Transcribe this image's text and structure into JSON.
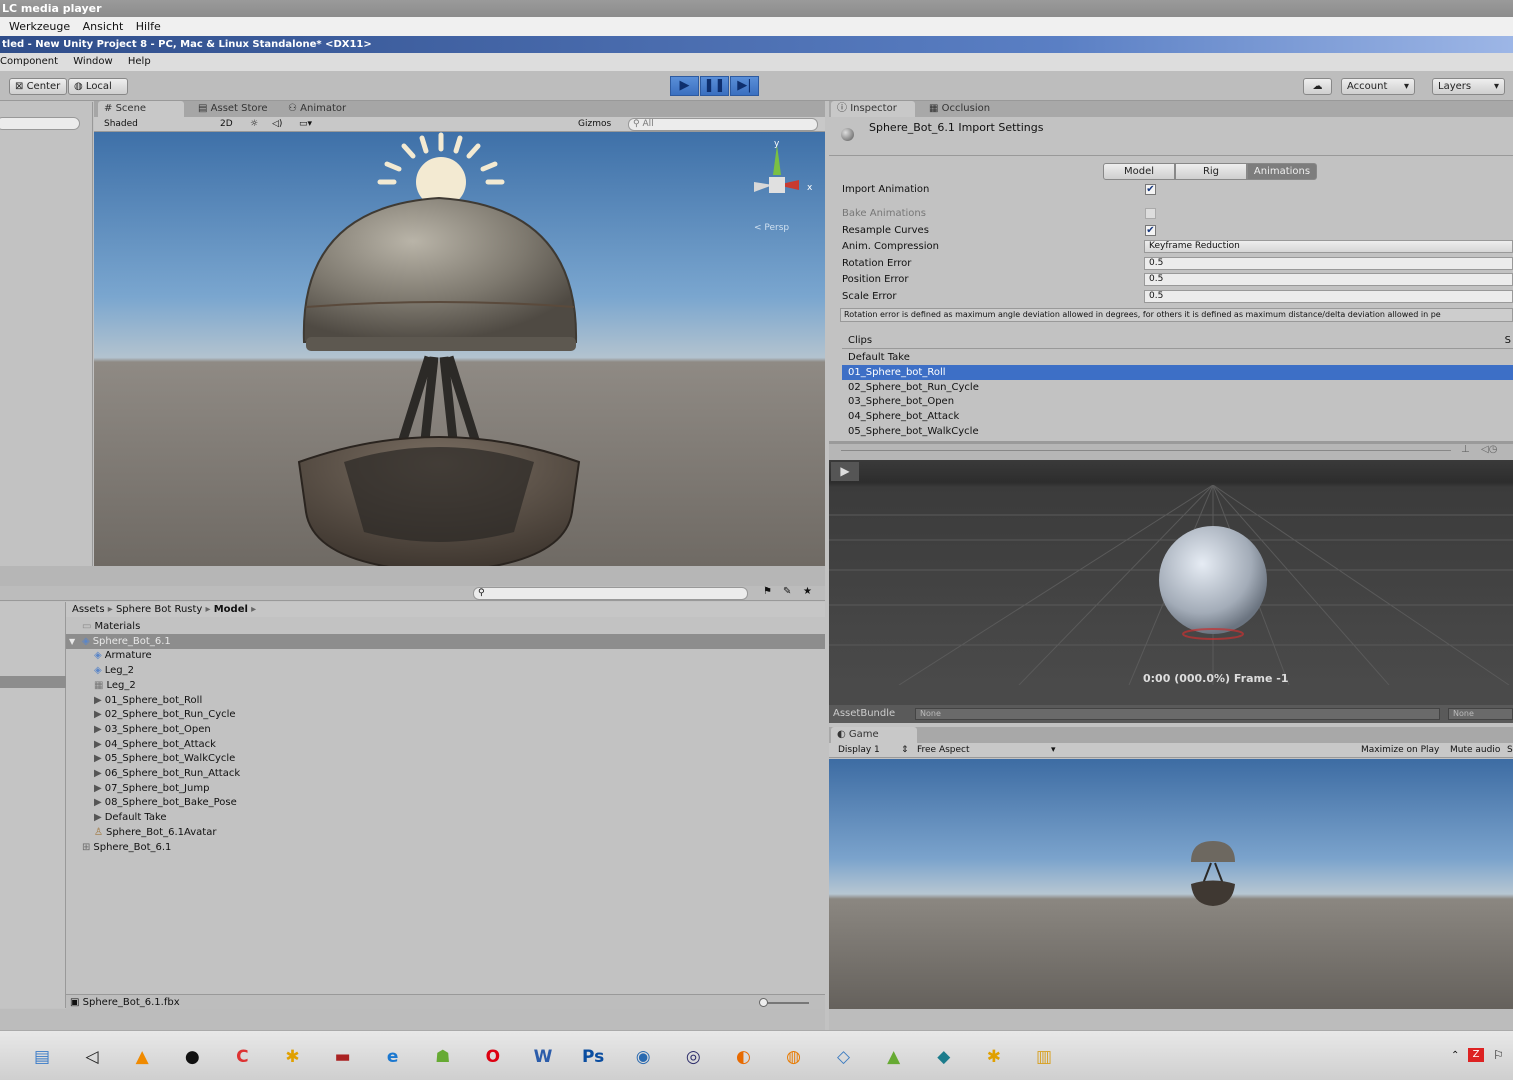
{
  "vlc": {
    "title": "LC media player",
    "menu": [
      "Werkzeuge",
      "Ansicht",
      "Hilfe"
    ]
  },
  "unity": {
    "title": "tled - New Unity Project 8 - PC, Mac & Linux Standalone* <DX11>",
    "menu": [
      "Component",
      "Window",
      "Help"
    ],
    "toolbar": {
      "center": "Center",
      "local": "Local",
      "account": "Account",
      "layers": "Layers"
    },
    "scene": {
      "tabs": [
        "Scene",
        "Asset Store",
        "Animator"
      ],
      "shading": "Shaded",
      "mode_2d": "2D",
      "gizmos": "Gizmos",
      "search": "All",
      "persp": "< Persp",
      "axis_x": "x",
      "axis_y": "y"
    },
    "project": {
      "breadcrumb": [
        "Assets",
        "Sphere Bot Rusty",
        "Model"
      ],
      "items": [
        {
          "name": "Materials",
          "indent": 0,
          "icon": "folder"
        },
        {
          "name": "Sphere_Bot_6.1",
          "indent": 0,
          "icon": "model",
          "selected": true
        },
        {
          "name": "Armature",
          "indent": 1,
          "icon": "model"
        },
        {
          "name": "Leg_2",
          "indent": 1,
          "icon": "model"
        },
        {
          "name": "Leg_2",
          "indent": 1,
          "icon": "mesh"
        },
        {
          "name": "01_Sphere_bot_Roll",
          "indent": 1,
          "icon": "anim"
        },
        {
          "name": "02_Sphere_bot_Run_Cycle",
          "indent": 1,
          "icon": "anim"
        },
        {
          "name": "03_Sphere_bot_Open",
          "indent": 1,
          "icon": "anim"
        },
        {
          "name": "04_Sphere_bot_Attack",
          "indent": 1,
          "icon": "anim"
        },
        {
          "name": "05_Sphere_bot_WalkCycle",
          "indent": 1,
          "icon": "anim"
        },
        {
          "name": "06_Sphere_bot_Run_Attack",
          "indent": 1,
          "icon": "anim"
        },
        {
          "name": "07_Sphere_bot_Jump",
          "indent": 1,
          "icon": "anim"
        },
        {
          "name": "08_Sphere_bot_Bake_Pose",
          "indent": 1,
          "icon": "anim"
        },
        {
          "name": "Default Take",
          "indent": 1,
          "icon": "anim"
        },
        {
          "name": "Sphere_Bot_6.1Avatar",
          "indent": 1,
          "icon": "avatar"
        },
        {
          "name": "Sphere_Bot_6.1",
          "indent": 0,
          "icon": "prefab"
        }
      ],
      "footer": "Sphere_Bot_6.1.fbx"
    },
    "inspector": {
      "tabs": [
        "Inspector",
        "Occlusion"
      ],
      "title": "Sphere_Bot_6.1 Import Settings",
      "subtabs": [
        "Model",
        "Rig",
        "Animations"
      ],
      "import_animation": "Import Animation",
      "bake_animations": "Bake Animations",
      "resample_curves": "Resample Curves",
      "anim_compression": "Anim. Compression",
      "anim_compression_value": "Keyframe Reduction",
      "rotation_error": "Rotation Error",
      "rotation_error_value": "0.5",
      "position_error": "Position Error",
      "position_error_value": "0.5",
      "scale_error": "Scale Error",
      "scale_error_value": "0.5",
      "help_text": "Rotation error is defined as maximum angle deviation allowed in degrees, for others it is defined as maximum distance/delta deviation allowed in pe",
      "clips_header": "Clips",
      "clips_header_right": "S",
      "clips": [
        "Default Take",
        "01_Sphere_bot_Roll",
        "02_Sphere_bot_Run_Cycle",
        "03_Sphere_bot_Open",
        "04_Sphere_bot_Attack",
        "05_Sphere_bot_WalkCycle"
      ],
      "preview_time": "0:00 (000.0%) Frame -1",
      "assetbundle_label": "AssetBundle",
      "assetbundle_value": "None",
      "assetbundle_variant": "None"
    },
    "game": {
      "tab": "Game",
      "display": "Display 1",
      "aspect": "Free Aspect",
      "maximize": "Maximize on Play",
      "mute": "Mute audio",
      "stats": "S"
    }
  },
  "taskbar": {
    "icons": [
      "explorer-icon",
      "unity-icon",
      "vlc-icon",
      "obs-icon",
      "ccleaner-icon",
      "tool-icon",
      "recorder-icon",
      "ie-icon",
      "android-icon",
      "opera-icon",
      "word-icon",
      "photoshop-icon",
      "thunderbird-icon",
      "eclipse-icon",
      "firefox-icon",
      "blender-icon",
      "box-icon",
      "android-studio-icon",
      "mysql-icon",
      "tool2-icon",
      "folder-icon"
    ]
  }
}
